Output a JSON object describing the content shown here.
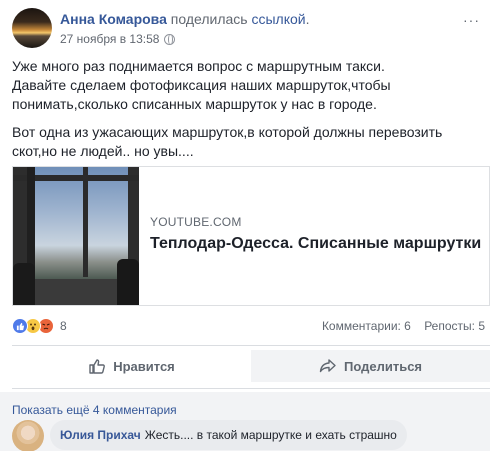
{
  "post": {
    "author": "Анна Комарова",
    "action_text": "поделилась",
    "action_link": "ссылкой",
    "action_period": ".",
    "timestamp": "27 ноября в 13:58",
    "menu": "···",
    "paragraphs": [
      "Уже много раз поднимается вопрос с маршрутным такси.\nДавайте сделаем фотофиксация наших маршруток,чтобы понимать,сколько списанных маршруток у нас в городе.",
      "Вот одна из ужасающих маршруток,в которой должны перевозить скот,но не людей.. но увы...."
    ]
  },
  "link_card": {
    "domain": "YOUTUBE.COM",
    "title": "Теплодар-Одесса. Списанные маршрутки"
  },
  "reactions": {
    "icons": [
      "like-icon",
      "wow-icon",
      "angry-icon"
    ],
    "count": "8",
    "comments": "Комментарии: 6",
    "shares": "Репосты: 5"
  },
  "actions": {
    "like_label": "Нравится",
    "share_label": "Поделиться"
  },
  "comments": {
    "show_more": "Показать ещё 4 комментария",
    "items": [
      {
        "author": "Юлия Прихач",
        "text": "Жесть.... в такой маршрутке и ехать страшно"
      }
    ]
  },
  "colors": {
    "link": "#365899",
    "muted": "#606770",
    "like_blue": "#4f7ae9"
  }
}
